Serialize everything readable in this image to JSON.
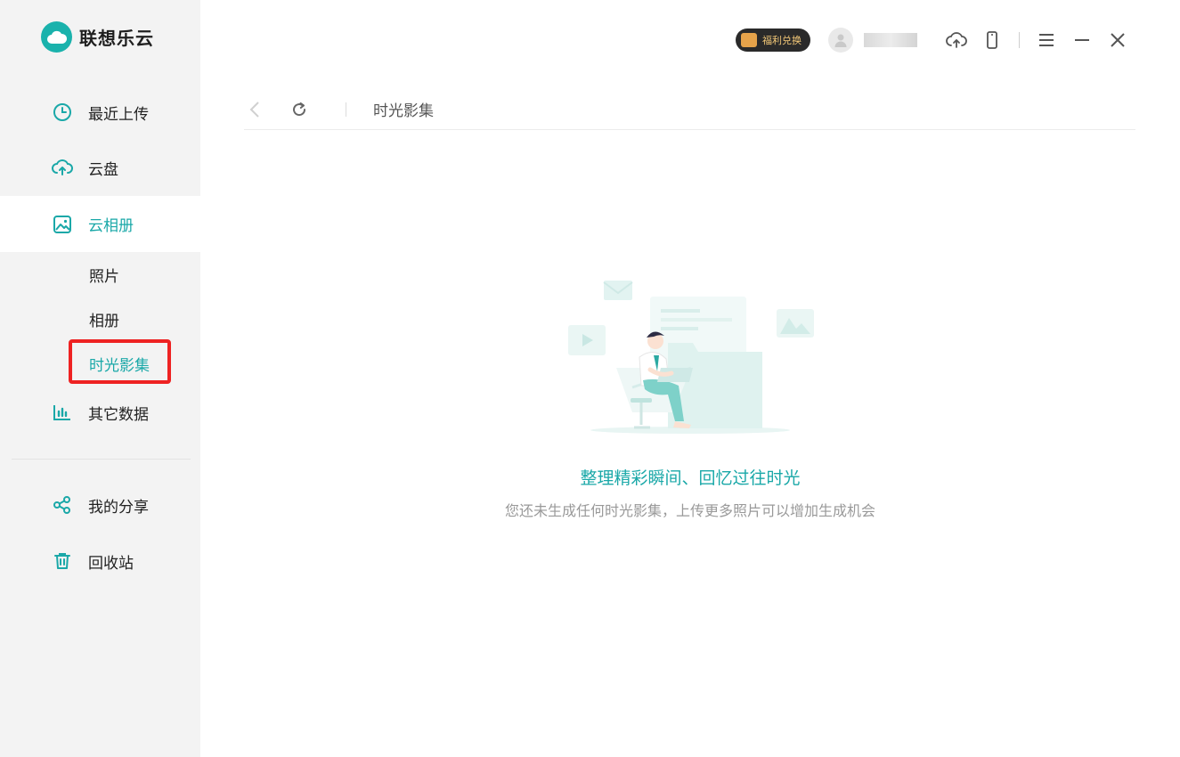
{
  "app": {
    "name": "联想乐云"
  },
  "sidebar": {
    "items": [
      {
        "label": "最近上传",
        "icon": "clock-icon"
      },
      {
        "label": "云盘",
        "icon": "cloud-upload-icon"
      },
      {
        "label": "云相册",
        "icon": "image-icon",
        "active": true
      },
      {
        "label": "其它数据",
        "icon": "bar-chart-icon"
      },
      {
        "label": "我的分享",
        "icon": "share-icon"
      },
      {
        "label": "回收站",
        "icon": "trash-icon"
      }
    ],
    "subitems": [
      {
        "label": "照片"
      },
      {
        "label": "相册"
      },
      {
        "label": "时光影集",
        "active": true
      }
    ]
  },
  "topbar": {
    "promo_label": "福利兑换",
    "icons": [
      "user-avatar-icon",
      "cloud-upload-icon",
      "phone-icon",
      "menu-icon",
      "minimize-icon",
      "close-icon"
    ]
  },
  "breadcrumb": {
    "current": "时光影集"
  },
  "empty_state": {
    "title": "整理精彩瞬间、回忆过往时光",
    "subtitle": "您还未生成任何时光影集，上传更多照片可以增加生成机会"
  },
  "colors": {
    "accent": "#1aa8a8",
    "highlight": "#ee2222",
    "sidebar_bg": "#f3f3f3"
  }
}
